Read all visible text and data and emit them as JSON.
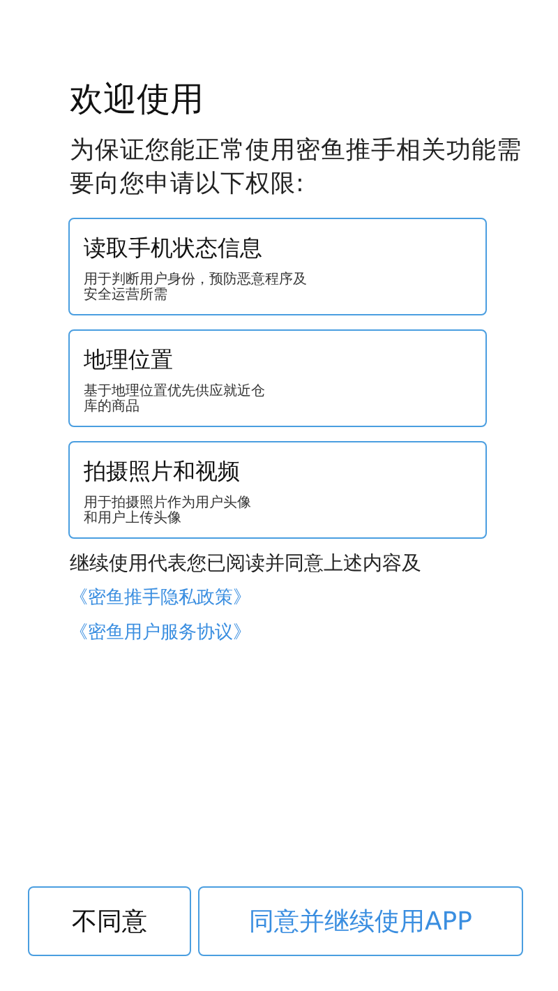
{
  "title": "欢迎使用",
  "intro": "为保证您能正常使用密鱼推手相关功能需要向您申请以下权限:",
  "permissions": [
    {
      "title": "读取手机状态信息",
      "description": [
        "用于判断用户身份，预防恶意程序及",
        "安全运营所需"
      ]
    },
    {
      "title": "地理位置",
      "description": [
        "基于地理位置优先供应就近仓",
        "库的商品"
      ]
    },
    {
      "title": "拍摄照片和视频",
      "description": [
        "用于拍摄照片作为用户头像",
        "和用户上传头像"
      ]
    }
  ],
  "consent": "继续使用代表您已阅读并同意上述内容及",
  "links": [
    "《密鱼推手隐私政策》",
    "《密鱼用户服务协议》"
  ],
  "buttons": [
    {
      "label": "不同意",
      "kind": "plain"
    },
    {
      "label": "同意并继续使用APP",
      "kind": "primary"
    }
  ]
}
